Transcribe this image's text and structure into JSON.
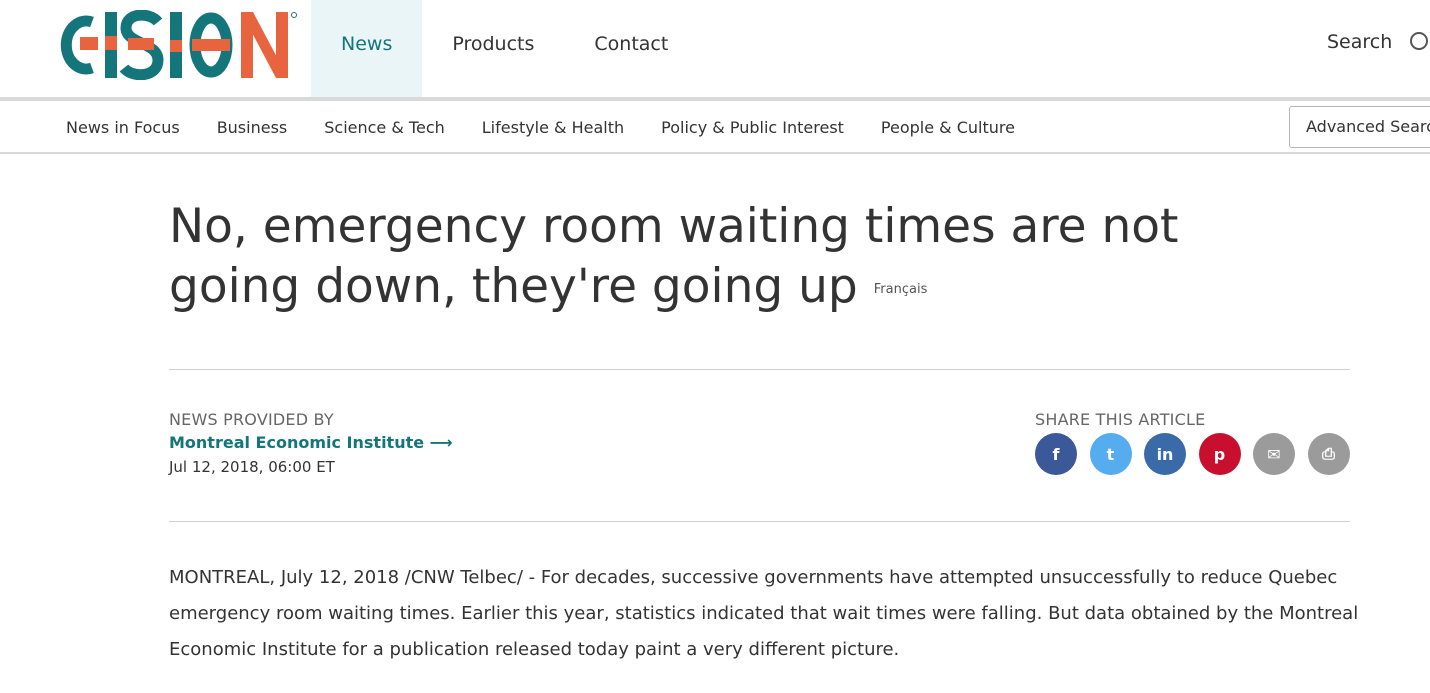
{
  "header": {
    "logo_text": "CISION",
    "nav": [
      {
        "label": "News",
        "active": true
      },
      {
        "label": "Products",
        "active": false
      },
      {
        "label": "Contact",
        "active": false
      }
    ],
    "search_label": "Search"
  },
  "categories": [
    "News in Focus",
    "Business",
    "Science & Tech",
    "Lifestyle & Health",
    "Policy & Public Interest",
    "People & Culture"
  ],
  "advanced_search_label": "Advanced Search",
  "article": {
    "title": "No, emergency room waiting times are not going down, they're going up",
    "language_link": "Français",
    "provided_by_label": "NEWS PROVIDED BY",
    "organization": "Montreal Economic Institute",
    "organization_arrow": "⟶",
    "date": "Jul 12, 2018, 06:00 ET",
    "share_label": "SHARE THIS ARTICLE",
    "body": "MONTREAL, July 12, 2018 /CNW Telbec/ - For decades, successive governments have attempted unsuccessfully to reduce Quebec emergency room waiting times. Earlier this year, statistics indicated that wait times were falling. But data obtained by the Montreal Economic Institute for a publication released today paint a very different picture."
  },
  "share_buttons": [
    {
      "name": "facebook-icon",
      "glyph": "f",
      "color": "#3b5998"
    },
    {
      "name": "twitter-icon",
      "glyph": "t",
      "color": "#55acee"
    },
    {
      "name": "linkedin-icon",
      "glyph": "in",
      "color": "#3a6aa8"
    },
    {
      "name": "pinterest-icon",
      "glyph": "p",
      "color": "#c8102e"
    },
    {
      "name": "email-icon",
      "glyph": "✉",
      "color": "#9b9b9b"
    },
    {
      "name": "print-icon",
      "glyph": "⎙",
      "color": "#9b9b9b"
    }
  ],
  "colors": {
    "brand_teal": "#14757a",
    "brand_orange": "#e8643f",
    "nav_active_bg": "#e9f5f6"
  }
}
